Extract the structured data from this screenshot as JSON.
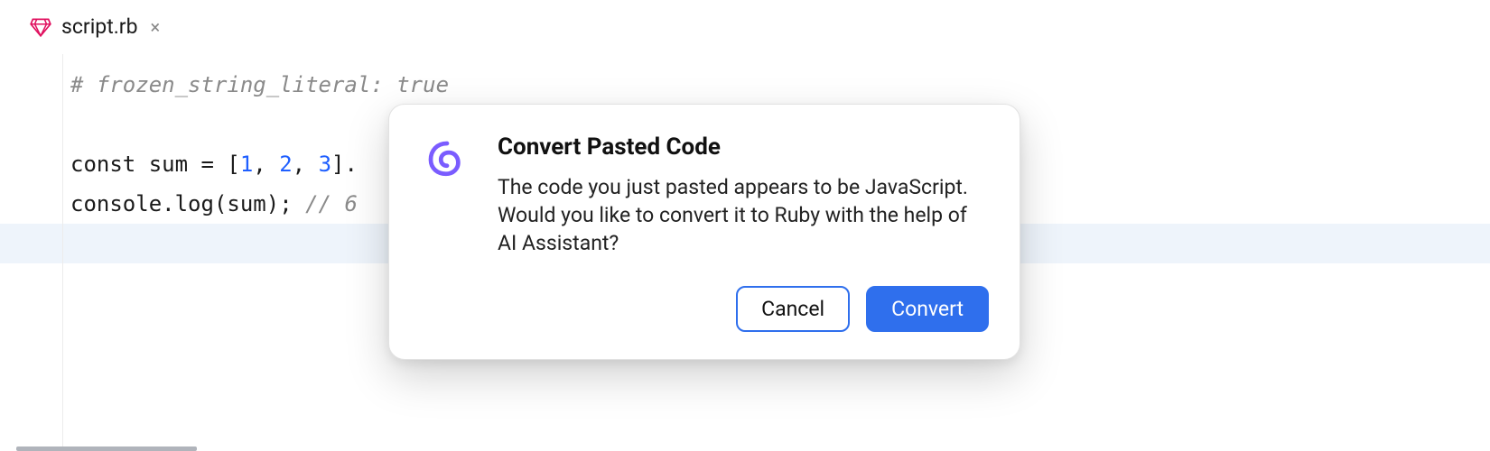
{
  "tab": {
    "filename": "script.rb",
    "icon": "ruby-icon"
  },
  "code": {
    "line1_comment": "# frozen_string_literal: true",
    "line3_pre": "const sum = [",
    "line3_n1": "1",
    "line3_sep1": ", ",
    "line3_n2": "2",
    "line3_sep2": ", ",
    "line3_n3": "3",
    "line3_post": "].",
    "line3_tail": ";",
    "line4_pre": "console.log(sum); ",
    "line4_comment": "// 6"
  },
  "dialog": {
    "title": "Convert Pasted Code",
    "message": "The code you just pasted appears to be JavaScript. Would you like to convert it to Ruby with the help of AI Assistant?",
    "cancel_label": "Cancel",
    "convert_label": "Convert"
  }
}
